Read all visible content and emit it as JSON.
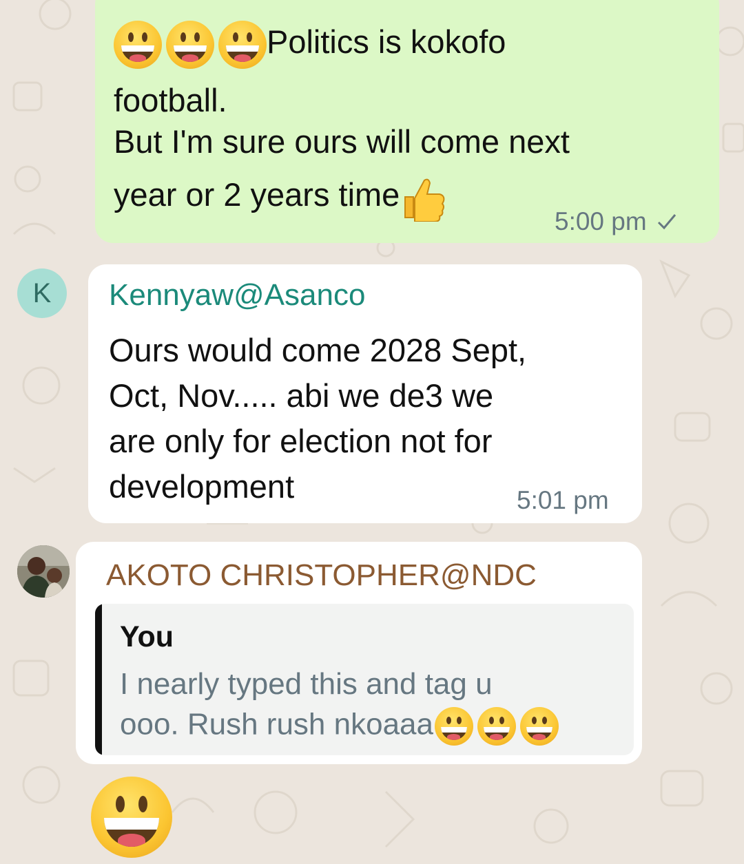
{
  "messages": {
    "outgoing": {
      "line1": "Politics is kokofo",
      "line2": "football.",
      "line3": "But I'm sure ours will come next",
      "line4": "year or 2 years time",
      "time": "5:00 pm",
      "status_icon": "single-check-icon"
    },
    "kenny": {
      "avatar_letter": "K",
      "sender": "Kennyaw@Asanco",
      "sender_color": "#1B8A7A",
      "line1": "Ours would come 2028 Sept,",
      "line2": "Oct, Nov..... abi we de3 we",
      "line3": "are only for election not for",
      "line4": "development",
      "time": "5:01 pm"
    },
    "akoto": {
      "sender": "AKOTO CHRISTOPHER@NDC",
      "sender_color": "#8B5A32",
      "quote_author": "You",
      "quote_line1": "I nearly typed this and tag u",
      "quote_line2": "ooo. Rush rush nkoaaa"
    }
  },
  "icons": {
    "emoji": "grinning-face-icon",
    "thumb": "thumbs-up-icon"
  }
}
